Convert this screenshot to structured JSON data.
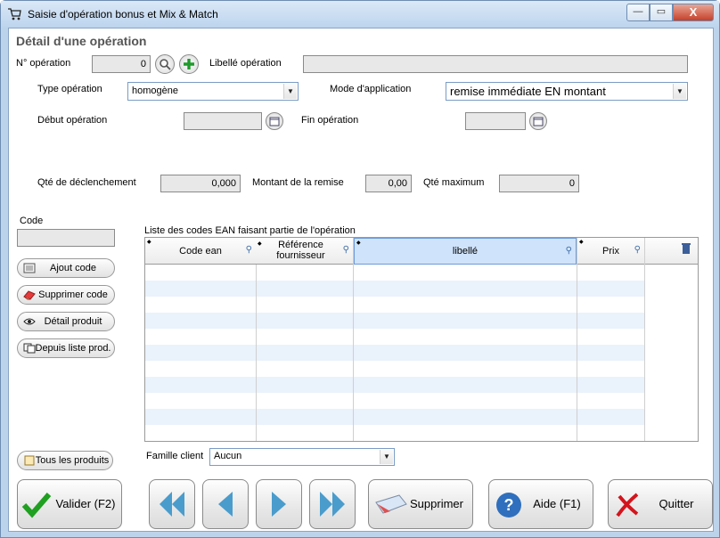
{
  "window": {
    "title": "Saisie d'opération bonus et Mix & Match",
    "min_label": "—",
    "max_label": "▭",
    "close_label": "X"
  },
  "section_title": "Détail d'une opération",
  "fields": {
    "num_operation_label": "N° opération",
    "num_operation_value": "0",
    "libelle_label": "Libellé opération",
    "libelle_value": "",
    "type_label": "Type opération",
    "type_value": "homogène",
    "mode_label": "Mode d'application",
    "mode_value": "remise immédiate EN montant",
    "debut_label": "Début opération",
    "debut_value": "",
    "fin_label": "Fin opération",
    "fin_value": "",
    "qte_declenchement_label": "Qté de déclenchement",
    "qte_declenchement_value": "0,000",
    "montant_remise_label": "Montant de la remise",
    "montant_remise_value": "0,00",
    "qte_maximum_label": "Qté maximum",
    "qte_maximum_value": "0",
    "code_label": "Code",
    "code_value": ""
  },
  "side_buttons": {
    "ajout_code": "Ajout code",
    "supprimer_code": "Supprimer code",
    "detail_produit": "Détail produit",
    "depuis_liste": "Depuis liste prod.",
    "tous_produits": "Tous les produits"
  },
  "grid": {
    "caption": "Liste des codes EAN faisant partie de l'opération",
    "columns": [
      "Code ean",
      "Référence fournisseur",
      "libellé",
      "Prix"
    ]
  },
  "famille": {
    "label": "Famille client",
    "value": "Aucun"
  },
  "bottom_buttons": {
    "valider": "Valider (F2)",
    "supprimer": "Supprimer",
    "aide": "Aide (F1)",
    "quitter": "Quitter"
  },
  "colors": {
    "titlebar": "#bdd4ee",
    "grid_row_alt": "#eaf2fc",
    "selected_header": "#cfe3fb"
  }
}
